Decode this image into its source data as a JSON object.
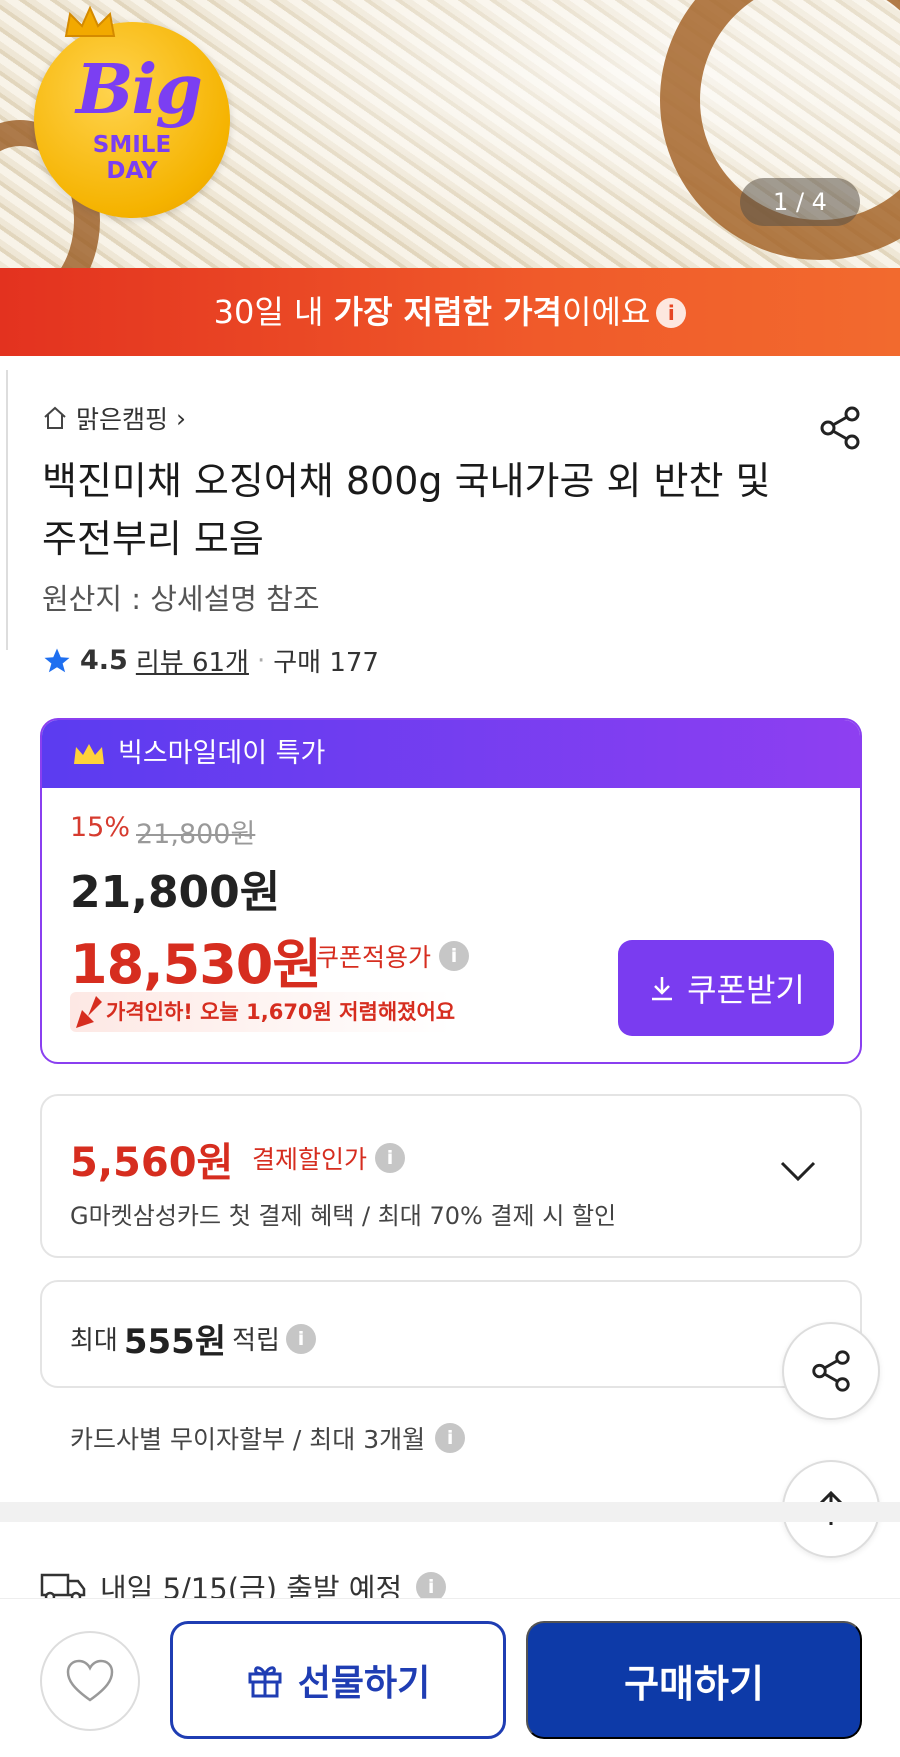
{
  "hero": {
    "badge_big": "Big",
    "badge_line1": "SMILE",
    "badge_line2": "DAY",
    "pager": "1 / 4"
  },
  "banner": {
    "prefix": "30일 내 ",
    "bold": "가장 저렴한 가격",
    "suffix": "이에요"
  },
  "product": {
    "store": "맑은캠핑",
    "title": "백진미채 오징어채 800g 국내가공 외 반찬 및 주전부리 모음",
    "origin": "원산지 : 상세설명 참조",
    "rating": "4.5",
    "reviews": "리뷰 61개",
    "purchases": "구매 177"
  },
  "deal": {
    "header": "빅스마일데이 특가",
    "discount": "15%",
    "original_price": "21,800원",
    "price": "21,800원",
    "coupon_price": "18,530원",
    "coupon_label": "쿠폰적용가",
    "price_drop": "가격인하! 오늘 1,670원 저렴해졌어요",
    "coupon_button": "쿠폰받기"
  },
  "payment": {
    "amount": "5,560원",
    "label": "결제할인가",
    "desc": "G마켓삼성카드 첫 결제 혜택 / 최대 70% 결제 시 할인"
  },
  "points": {
    "prefix": "최대",
    "amount": "555원",
    "suffix": "적립"
  },
  "installment": "카드사별 무이자할부 / 최대 3개월",
  "shipping": "내일 5/15(금) 출발 예정",
  "bottom": {
    "gift": "선물하기",
    "buy": "구매하기"
  },
  "colors": {
    "accent_purple": "#7a3cf0",
    "price_red": "#d62d1f",
    "buy_blue": "#0d3aa8"
  }
}
